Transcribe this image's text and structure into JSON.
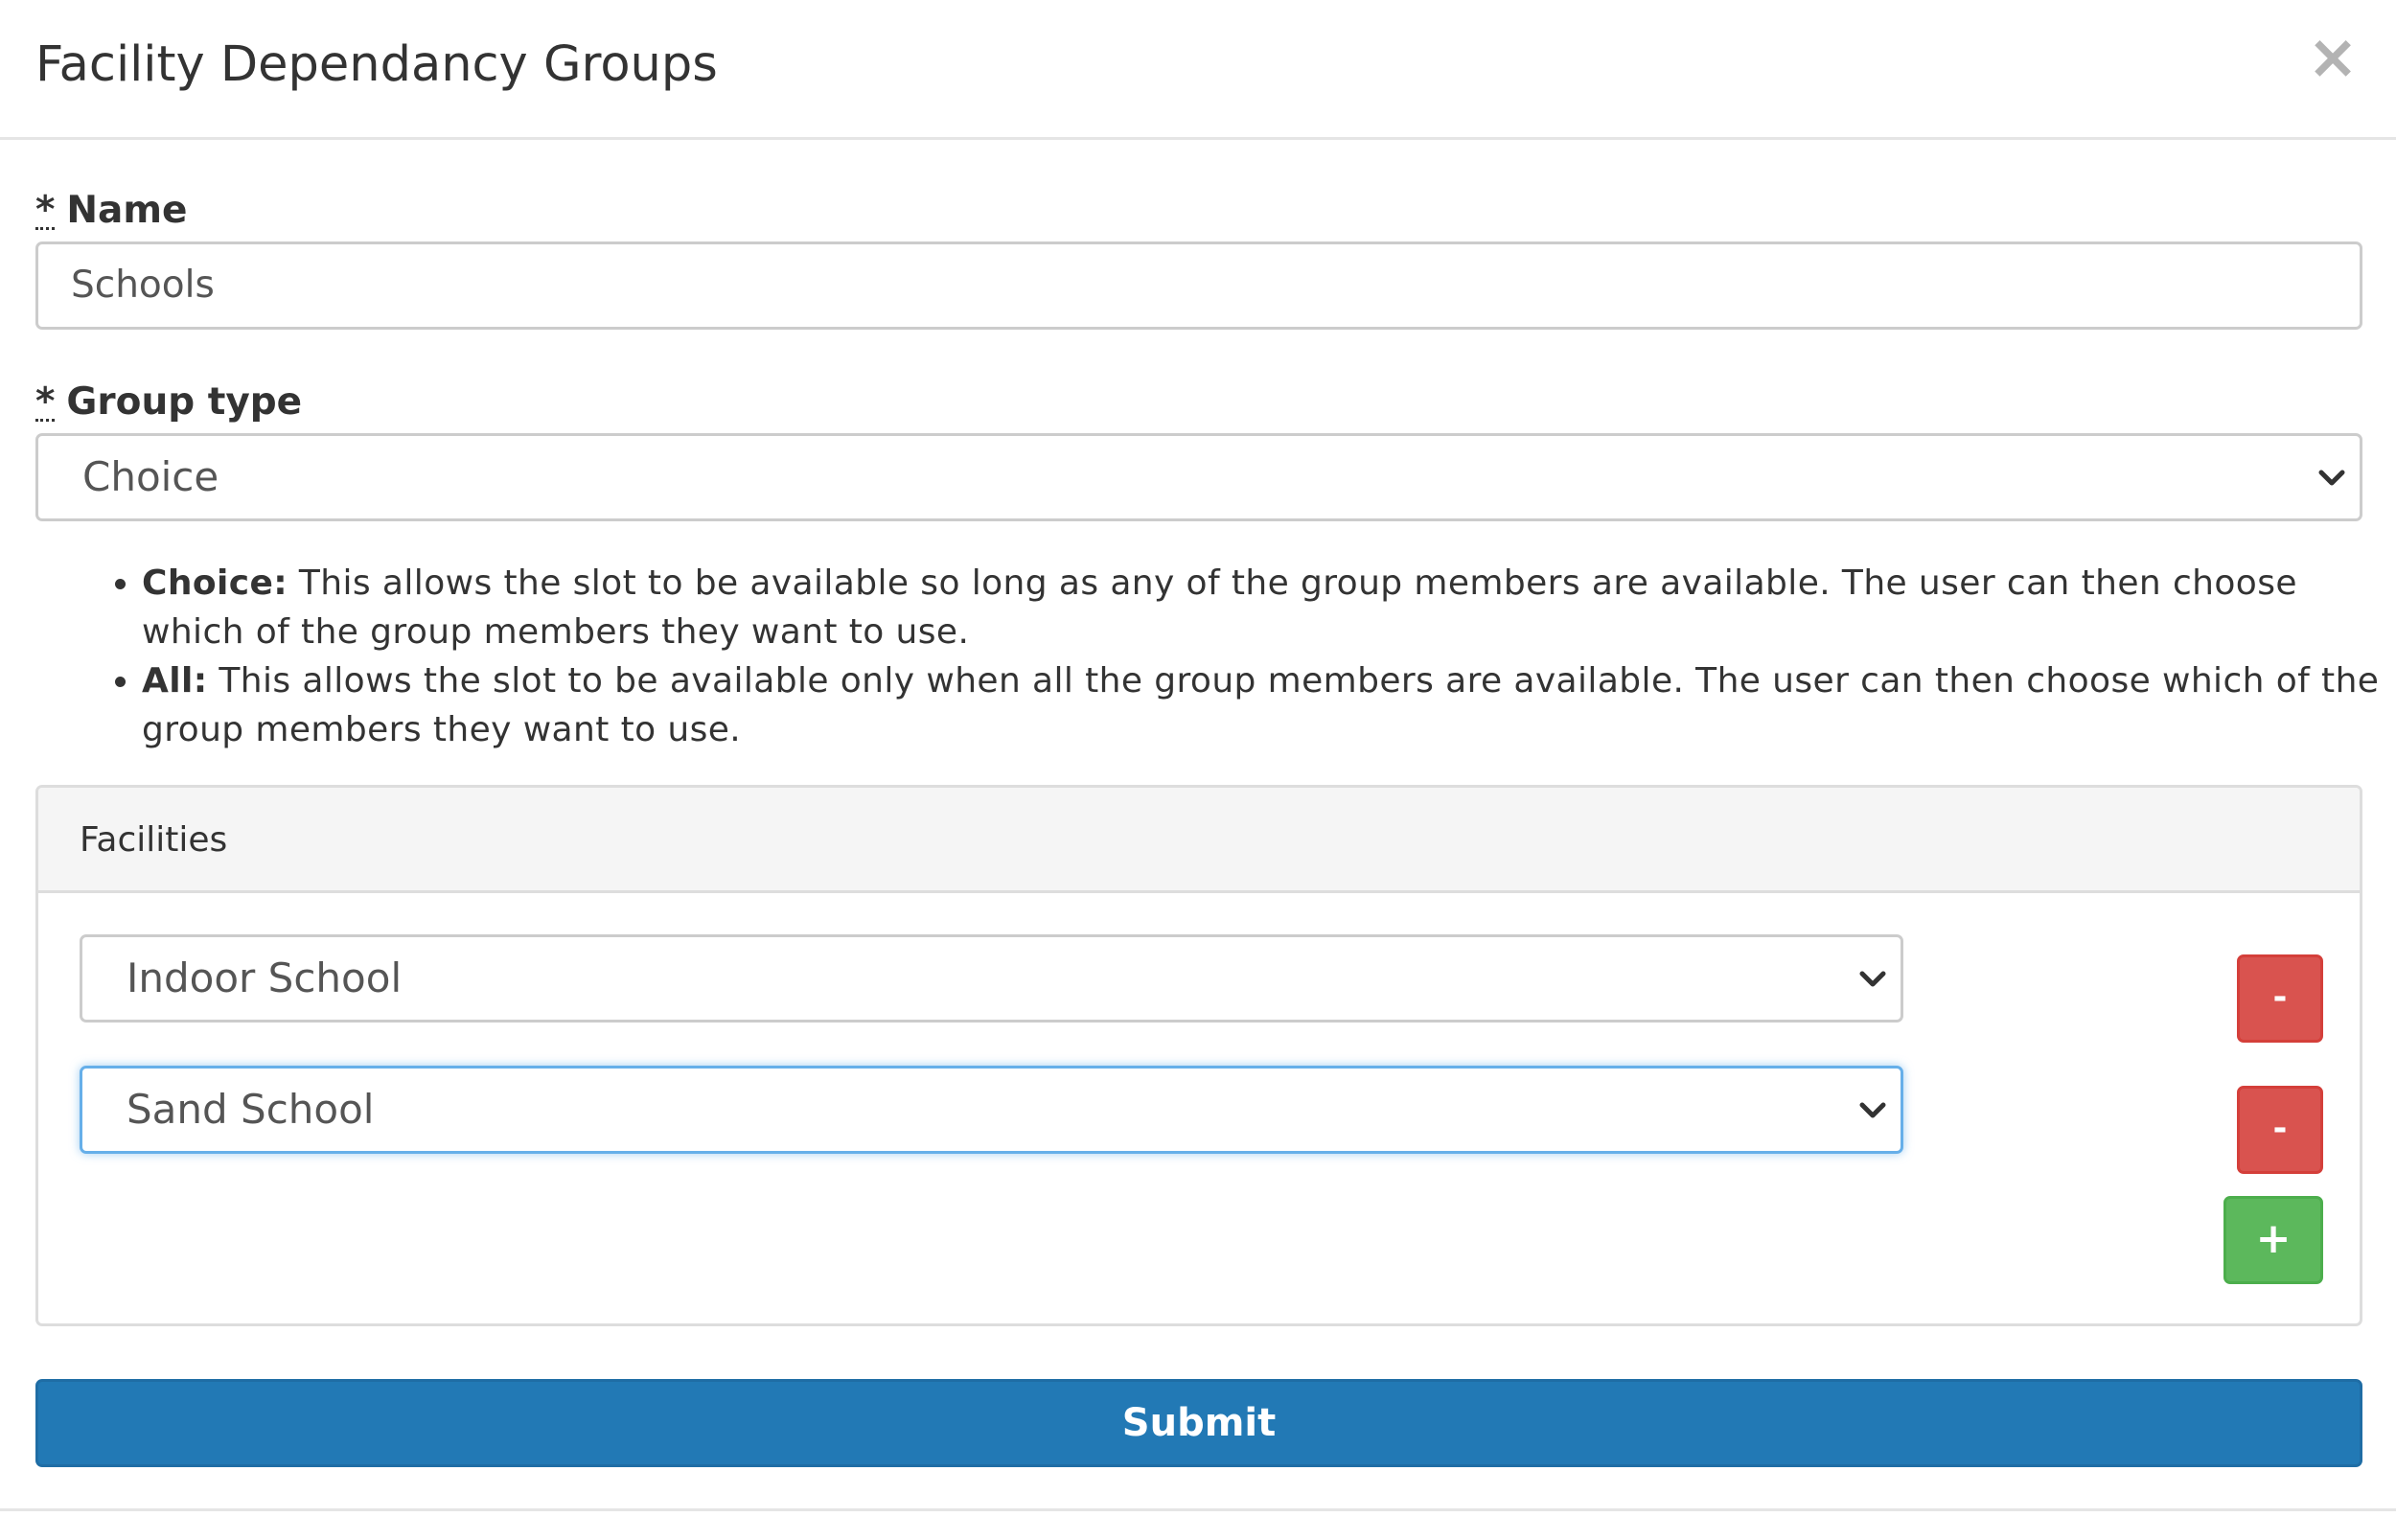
{
  "modal": {
    "title": "Facility Dependancy Groups",
    "close_symbol": "×"
  },
  "form": {
    "required_marker": "*",
    "name_label": "Name",
    "name_value": "Schools",
    "group_type_label": "Group type",
    "group_type_value": "Choice",
    "help": [
      {
        "term": "Choice:",
        "text": " This allows the slot to be available so long as any of the group members are available. The user can then choose which of the group members they want to use."
      },
      {
        "term": "All:",
        "text": " This allows the slot to be available only when all the group members are available. The user can then choose which of the group members they want to use."
      }
    ],
    "facilities": {
      "heading": "Facilities",
      "items": [
        {
          "value": "Indoor School",
          "remove_label": "-"
        },
        {
          "value": "Sand School",
          "remove_label": "-"
        }
      ],
      "add_label": "+"
    },
    "submit_label": "Submit"
  },
  "colors": {
    "primary": "#2279b5",
    "danger": "#d9534f",
    "success": "#5cb85c",
    "focus_border": "#66afe9"
  },
  "icons": {
    "close": "close-icon",
    "select_arrow": "chevron-down-icon"
  }
}
